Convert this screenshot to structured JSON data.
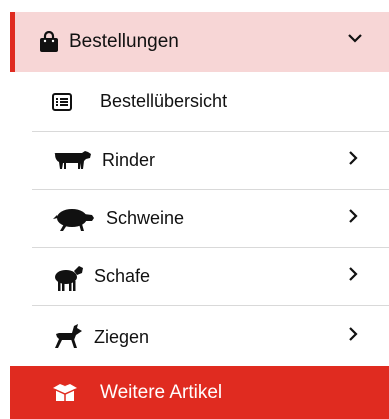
{
  "menu": {
    "header": {
      "label": "Bestellungen",
      "icon": "shopping-bag-icon",
      "expanded": true
    },
    "items": [
      {
        "label": "Bestellübersicht",
        "icon": "list-icon"
      },
      {
        "label": "Rinder",
        "icon": "cow-icon"
      },
      {
        "label": "Schweine",
        "icon": "pig-icon"
      },
      {
        "label": "Schafe",
        "icon": "sheep-icon"
      },
      {
        "label": "Ziegen",
        "icon": "goat-icon"
      }
    ],
    "footer": {
      "label": "Weitere Artikel",
      "icon": "box-icon"
    }
  },
  "colors": {
    "accent": "#e02b20",
    "header_bg": "#f7d6d6",
    "divider": "#d9d9d9"
  }
}
